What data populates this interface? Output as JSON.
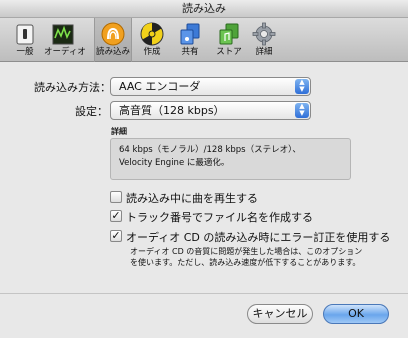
{
  "window": {
    "title": "読み込み"
  },
  "toolbar": {
    "items": [
      {
        "label": "一般",
        "icon": "switch-icon"
      },
      {
        "label": "オーディオ",
        "icon": "equalizer-icon"
      },
      {
        "label": "読み込み",
        "icon": "import-cd-icon",
        "selected": true
      },
      {
        "label": "作成",
        "icon": "burn-icon"
      },
      {
        "label": "共有",
        "icon": "share-icon"
      },
      {
        "label": "ストア",
        "icon": "store-icon"
      },
      {
        "label": "詳細",
        "icon": "gear-icon"
      }
    ]
  },
  "import": {
    "method_label": "読み込み方法：",
    "method_value": "AAC エンコーダ",
    "setting_label": "設定：",
    "setting_value": "高音質（128 kbps）",
    "detail_title": "詳細",
    "detail_line1": "64 kbps（モノラル）/128 kbps（ステレオ）、",
    "detail_line2": "Velocity Engine に最適化。"
  },
  "options": {
    "play_while_import": {
      "label": "読み込み中に曲を再生する",
      "checked": false
    },
    "track_numbers": {
      "label": "トラック番号でファイル名を作成する",
      "checked": true
    },
    "error_correction": {
      "label": "オーディオ CD の読み込み時にエラー訂正を使用する",
      "checked": true
    },
    "error_note_line1": "オーディオ CD の音質に問題が発生した場合は、このオプション",
    "error_note_line2": "を使います。ただし、読み込み速度が低下することがあります。"
  },
  "buttons": {
    "cancel": "キャンセル",
    "ok": "OK"
  },
  "colors": {
    "accent": "#2f6fd8",
    "default_button": "#6aa6ec"
  }
}
